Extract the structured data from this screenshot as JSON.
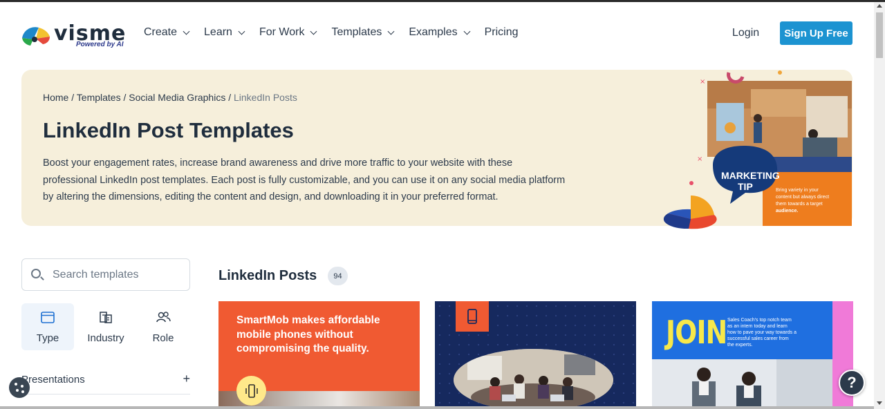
{
  "brand": {
    "name": "visme",
    "tagline": "Powered by AI"
  },
  "nav": {
    "items": [
      {
        "label": "Create",
        "dropdown": true
      },
      {
        "label": "Learn",
        "dropdown": true
      },
      {
        "label": "For Work",
        "dropdown": true
      },
      {
        "label": "Templates",
        "dropdown": true
      },
      {
        "label": "Examples",
        "dropdown": true
      },
      {
        "label": "Pricing",
        "dropdown": false
      }
    ],
    "login": "Login",
    "signup": "Sign Up Free"
  },
  "breadcrumb": {
    "home": "Home",
    "templates": "Templates",
    "social": "Social Media Graphics",
    "current": "LinkedIn Posts",
    "separator": "/"
  },
  "hero": {
    "title": "LinkedIn Post Templates",
    "description": "Boost your engagement rates, increase brand awareness and drive more traffic to your website with these professional LinkedIn post templates. Each post is fully customizable, and you can use it on any social media platform by altering the dimensions, editing the content and design, and downloading it in your preferred format.",
    "art": {
      "bubble_line1": "MARKETING",
      "bubble_line2": "TIP",
      "tip_text_1": "Bring variety in your",
      "tip_text_2": "content but always direct",
      "tip_text_3": "them towards a target",
      "tip_text_4": "audience."
    }
  },
  "sidebar": {
    "search_placeholder": "Search templates",
    "filter_tabs": [
      {
        "label": "Type",
        "icon": "browser-window-icon",
        "active": true
      },
      {
        "label": "Industry",
        "icon": "buildings-icon",
        "active": false
      },
      {
        "label": "Role",
        "icon": "users-icon",
        "active": false
      }
    ],
    "accordion": {
      "label": "Presentations",
      "toggle": "+"
    }
  },
  "main": {
    "title": "LinkedIn Posts",
    "count": "94",
    "cards": [
      {
        "text": "SmartMob makes affordable mobile phones without compromising the quality.",
        "icon": "phone-vibrate-icon"
      },
      {
        "icon": "phone-icon"
      },
      {
        "headline": "JOIN",
        "text": "Sales Coach's top notch team as an intern today and learn how to pave your way towards a successful sales career from the experts."
      }
    ]
  },
  "help": {
    "label": "?"
  },
  "colors": {
    "accent": "#1c93d1",
    "hero_bg": "#f6efdb",
    "card1": "#f05a32",
    "card2": "#16295e",
    "card3": "#1f6fe0"
  }
}
